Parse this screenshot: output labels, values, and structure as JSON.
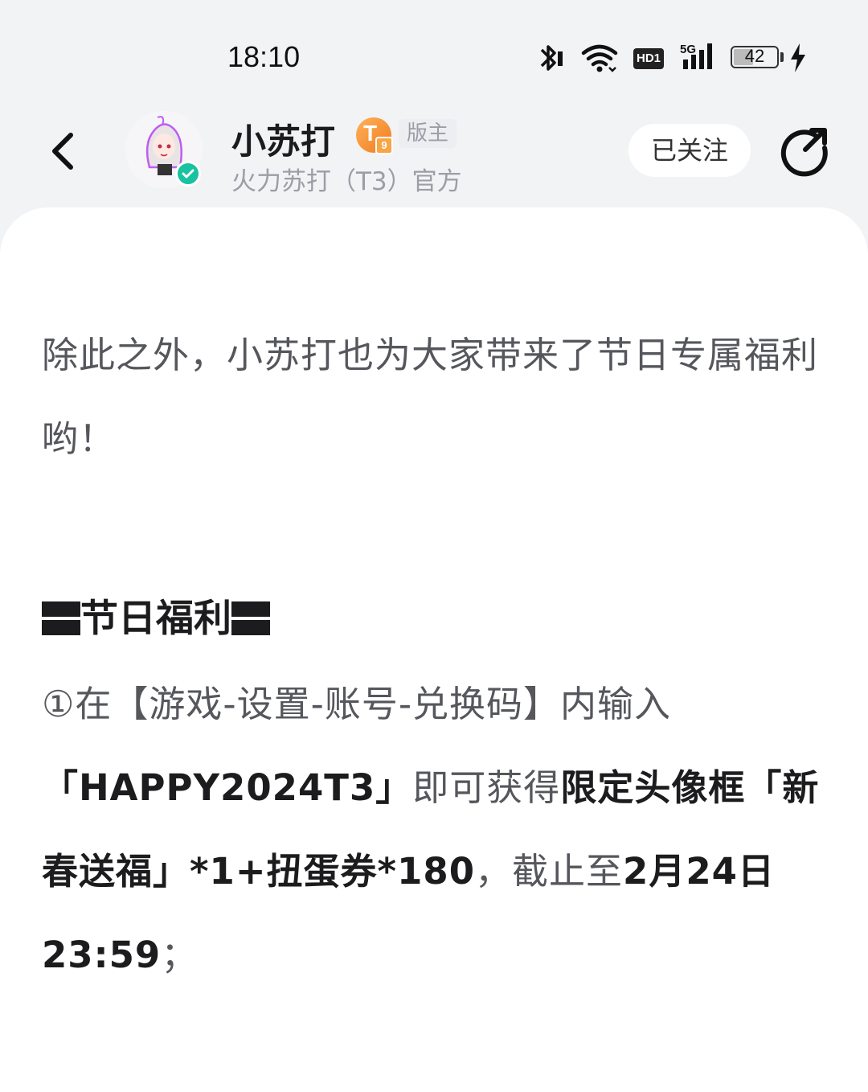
{
  "status_bar": {
    "time": "18:10",
    "network_badge": "HD1",
    "signal_label": "5G",
    "battery_level": "42",
    "icons": [
      "bluetooth-icon",
      "wifi-icon",
      "hd-icon",
      "signal-5g-icon",
      "battery-icon",
      "charging-icon"
    ]
  },
  "header": {
    "author_name": "小苏打",
    "level_badge": "T",
    "level_number": "9",
    "role_tag": "版主",
    "author_subtitle": "火力苏打（T3）官方",
    "follow_label": "已关注",
    "icons": [
      "back-icon",
      "avatar",
      "verified-icon",
      "share-icon"
    ]
  },
  "post": {
    "paragraph1": "除此之外，小苏打也为大家带来了节日专属福利哟！",
    "section_title": "节日福利",
    "p2": {
      "a": "①在【游戏-设置-账号-兑换码】内输入",
      "b": "「HAPPY2024T3」",
      "c": "即可获得",
      "d": "限定头像框「新春送福」*1+扭蛋券*180",
      "e": "，截止至",
      "f": "2月24日 23:59",
      "g": "；"
    }
  },
  "colors": {
    "background": "#f2f3f5",
    "verified": "#19c2a0",
    "badge": "#f07a1e",
    "body_text": "#55575c",
    "strong_text": "#1c1c1e"
  }
}
